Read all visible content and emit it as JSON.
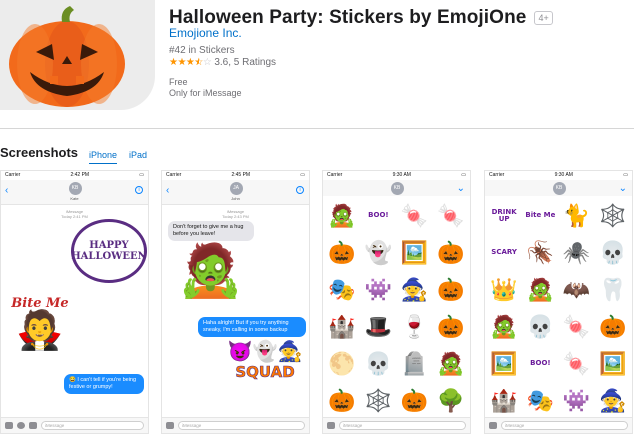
{
  "app": {
    "title": "Halloween Party: Stickers by EmojiOne",
    "age_rating": "4+",
    "developer": "Emojione Inc.",
    "rank": "#42 in Stickers",
    "rating_text": "3.6, 5 Ratings",
    "rating_value": 3.6,
    "price": "Free",
    "platform": "Only for iMessage"
  },
  "screenshots": {
    "title": "Screenshots",
    "tabs": [
      {
        "label": "iPhone",
        "active": true
      },
      {
        "label": "iPad",
        "active": false
      }
    ],
    "shots": [
      {
        "status_carrier": "Carrier",
        "status_time": "2:42 PM",
        "contact_initials": "KB",
        "contact_name": "Kate",
        "meta": "iMessage\nToday 2:41 PM",
        "sticker_1": "HAPPY HALLOWEEN",
        "sticker_2": "Bite Me",
        "bubble": "😂 I can't tell if you're being festive or grumpy!",
        "input_placeholder": "iMessage"
      },
      {
        "status_carrier": "Carrier",
        "status_time": "2:45 PM",
        "contact_initials": "JA",
        "contact_name": "John",
        "meta": "iMessage\nToday 2:43 PM",
        "bubble_gray": "Don't forget to give me a hug before you leave!",
        "bubble_blue": "Haha alright! But if you try anything sneaky, I'm calling in some backup",
        "sticker_squad": "SQUAD",
        "input_placeholder": "iMessage"
      },
      {
        "status_carrier": "Carrier",
        "status_time": "9:30 AM",
        "contact_initials": "KB",
        "contact_name": "Kate",
        "stickers": [
          "🧟",
          "BOO!",
          "🍬",
          "🍬",
          "🎃",
          "👻",
          "🖼️",
          "🎃",
          "🎭",
          "👾",
          "🧙",
          "🎃",
          "🏰",
          "🎩",
          "🍷",
          "🎃",
          "🌕",
          "💀",
          "🪦",
          "🧟",
          "🎃",
          "🕸️",
          "🎃",
          "🌳",
          "💀",
          "🍬",
          "🌑",
          "🎃"
        ],
        "input_placeholder": "iMessage"
      },
      {
        "status_carrier": "Carrier",
        "status_time": "9:30 AM",
        "contact_initials": "KB",
        "contact_name": "Kate",
        "stickers": [
          "DRINK UP",
          "Bite Me",
          "🐈",
          "🕸️",
          "SCARY",
          "🪳",
          "🕷️",
          "💀",
          "👑",
          "🧟",
          "🦇",
          "🦷",
          "🧟",
          "💀",
          "🍬",
          "🎃",
          "🖼️",
          "BOO!",
          "🍬",
          "🖼️",
          "🏰",
          "🎭",
          "👾",
          "🧙",
          "🎩",
          "🍷",
          "🎃",
          "🎃"
        ],
        "input_placeholder": "iMessage"
      }
    ]
  },
  "colors": {
    "link": "#0070c9",
    "star": "#ff9500",
    "bubble_blue": "#1a8cff",
    "pumpkin": "#f26a1b"
  },
  "icons": {
    "back": "chevron-left-icon",
    "info": "info-icon",
    "camera": "camera-icon",
    "heart": "digital-touch-icon",
    "apps": "app-store-icon",
    "mic": "microphone-icon"
  }
}
